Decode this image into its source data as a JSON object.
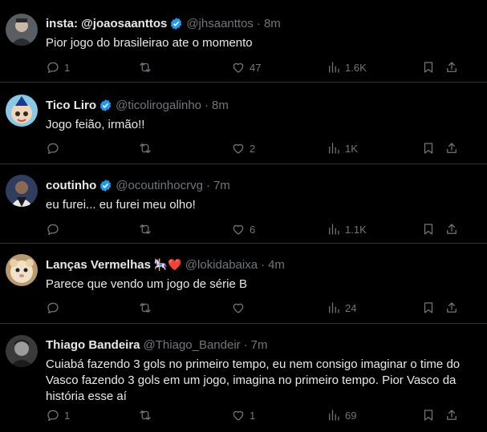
{
  "tweets": [
    {
      "name": "insta: @joaosaanttos",
      "emoji": "",
      "handle": "@jhsaanttos",
      "time": "8m",
      "text": "Pior jogo do brasileirao ate o momento",
      "replies": "1",
      "retweets": "",
      "likes": "47",
      "views": "1.6K",
      "verified": true,
      "avatar_color": "#6b6f73"
    },
    {
      "name": "Tico Liro",
      "emoji": "",
      "handle": "@ticolirogalinho",
      "time": "8m",
      "text": "Jogo feião, irmão!!",
      "replies": "",
      "retweets": "",
      "likes": "2",
      "views": "1K",
      "verified": true,
      "avatar_color": "#7ec8e3"
    },
    {
      "name": "coutinho",
      "emoji": "",
      "handle": "@ocoutinhocrvg",
      "time": "7m",
      "text": "eu furei... eu furei meu olho!",
      "replies": "",
      "retweets": "",
      "likes": "6",
      "views": "1.1K",
      "verified": true,
      "avatar_color": "#3b4b6b"
    },
    {
      "name": "Lanças Vermelhas",
      "emoji": "🎠❤️",
      "handle": "@lokidabaixa",
      "time": "4m",
      "text": "Parece que vendo um jogo de série B",
      "replies": "",
      "retweets": "",
      "likes": "",
      "views": "24",
      "verified": false,
      "avatar_color": "#d9c9a8"
    },
    {
      "name": "Thiago Bandeira",
      "emoji": "",
      "handle": "@Thiago_Bandeir",
      "time": "7m",
      "text": "Cuiabá fazendo 3 gols no primeiro tempo, eu nem consigo imaginar o time do Vasco fazendo 3 gols em um jogo, imagina no primeiro tempo. Pior Vasco da história esse aí",
      "replies": "1",
      "retweets": "",
      "likes": "1",
      "views": "69",
      "verified": false,
      "avatar_color": "#4a4a4a"
    }
  ],
  "colors": {
    "background": "#000000",
    "text": "#e7e9ea",
    "muted": "#71767b",
    "verified_blue": "#1d9bf0",
    "divider": "#2f3336"
  }
}
